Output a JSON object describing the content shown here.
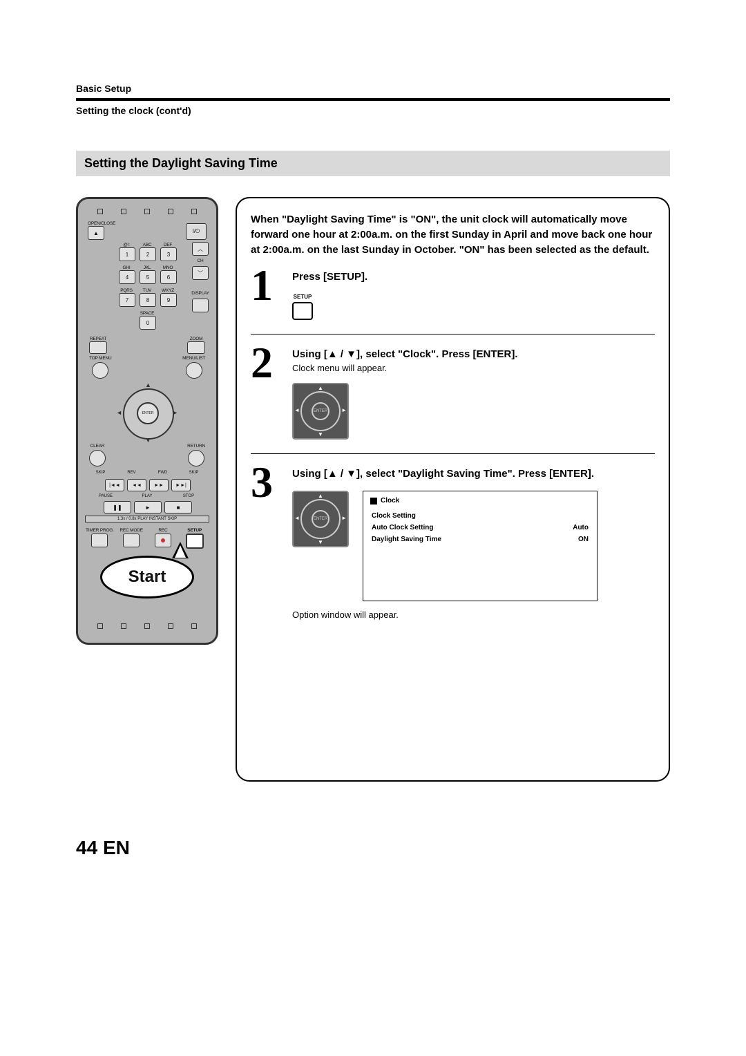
{
  "header": {
    "breadcrumb": "Basic Setup",
    "subtitle": "Setting the clock (cont'd)"
  },
  "section": {
    "title": "Setting the Daylight Saving Time"
  },
  "intro": "When \"Daylight Saving Time\" is \"ON\", the unit clock will automatically move forward one hour at 2:00a.m. on the first Sunday in April and move back one hour at 2:00a.m. on the last Sunday in October.\n\"ON\" has been selected as the default.",
  "steps": [
    {
      "num": "1",
      "heading": "Press [SETUP].",
      "icon_label": "SETUP"
    },
    {
      "num": "2",
      "heading": "Using [▲ / ▼], select \"Clock\". Press [ENTER].",
      "note": "Clock menu will appear.",
      "dpad_center": "ENTER"
    },
    {
      "num": "3",
      "heading": "Using [▲ / ▼], select \"Daylight Saving Time\". Press [ENTER].",
      "dpad_center": "ENTER",
      "osd": {
        "title": "Clock",
        "rows": [
          {
            "label": "Clock Setting",
            "value": ""
          },
          {
            "label": "Auto Clock Setting",
            "value": "Auto"
          },
          {
            "label": "Daylight Saving Time",
            "value": "ON"
          }
        ]
      },
      "foot_note": "Option window will appear."
    }
  ],
  "remote": {
    "labels": {
      "openclose": "OPEN/CLOSE",
      "power_icon": "I/⏻",
      "symbols_row": [
        "@!:",
        "ABC",
        "DEF"
      ],
      "letters_row2": [
        "GHI",
        "JKL",
        "MNO"
      ],
      "letters_row3": [
        "PQRS",
        "TUV",
        "WXYZ"
      ],
      "space": "SPACE",
      "ch": "CH",
      "display": "DISPLAY",
      "repeat": "REPEAT",
      "zoom": "ZOOM",
      "top_menu": "TOP MENU",
      "menu_list": "MENU/LIST",
      "enter": "ENTER",
      "clear": "CLEAR",
      "return": "RETURN",
      "skip": "SKIP",
      "rev": "REV",
      "fwd": "FWD",
      "pause": "PAUSE",
      "play": "PLAY",
      "stop": "STOP",
      "strip": "1.3x / 0.8x PLAY   INSTANT SKIP",
      "timer_prog": "TIMER PROG.",
      "rec_mode": "REC MODE",
      "rec": "REC",
      "setup": "SETUP"
    },
    "numbers": [
      "1",
      "2",
      "3",
      "4",
      "5",
      "6",
      "7",
      "8",
      "9",
      "0"
    ],
    "transport_icons": [
      "|◄◄",
      "◄◄",
      "►►",
      "►►|"
    ],
    "transport3_icons": [
      "❚❚",
      "►",
      "■"
    ]
  },
  "speech_bubble": "Start",
  "footer": {
    "page": "44",
    "lang": "EN"
  }
}
